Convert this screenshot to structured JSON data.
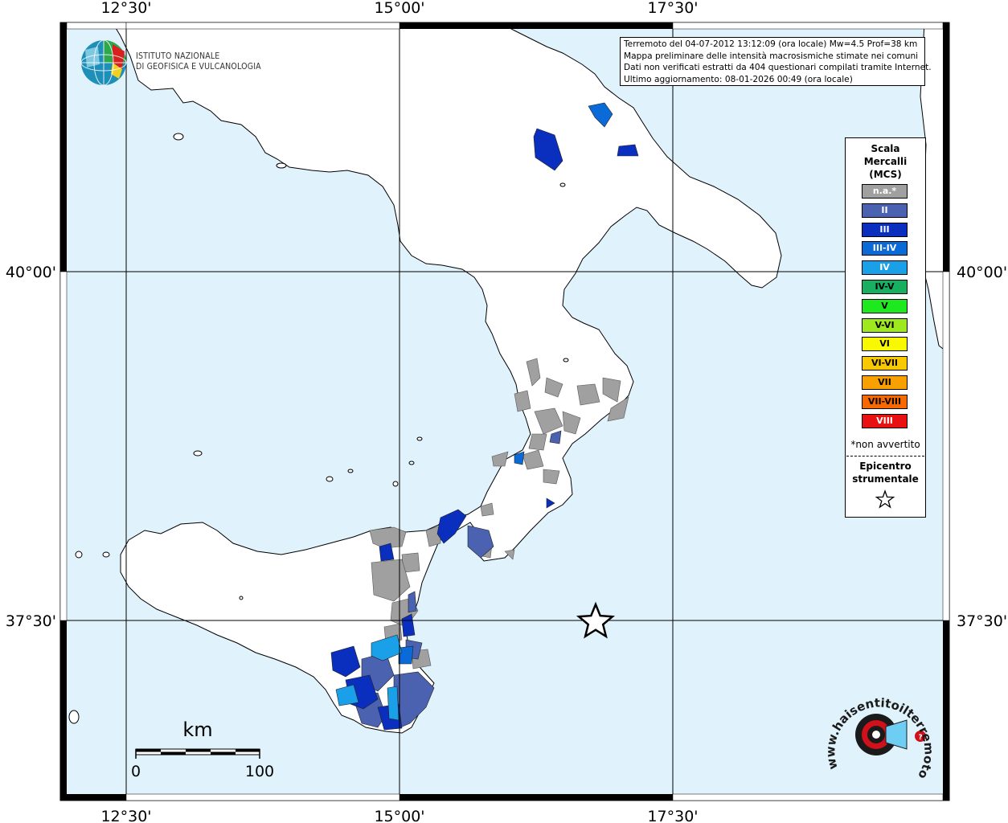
{
  "map": {
    "lon_labels": [
      "12°30'",
      "15°00'",
      "17°30'"
    ],
    "lat_labels": [
      "40°00'",
      "37°30'"
    ],
    "scale_bar": {
      "unit": "km",
      "start": "0",
      "end": "100"
    }
  },
  "logo": {
    "line1": "ISTITUTO NAZIONALE",
    "line2": "DI GEOFISICA E VULCANOLOGIA"
  },
  "info": {
    "line1": "Terremoto del 04-07-2012 13:12:09 (ora locale) Mw=4.5 Prof=38 km",
    "line2": "Mappa preliminare delle intensità macrosismiche stimate nei comuni",
    "line3": "Dati non verificati estratti da 404 questionari compilati tramite Internet.",
    "line4": "Ultimo aggiornamento: 08-01-2026 00:49 (ora locale)"
  },
  "legend": {
    "title_line1": "Scala",
    "title_line2": "Mercalli",
    "title_line3": "(MCS)",
    "items": [
      {
        "label": "n.a.*",
        "color": "#a0a0a0",
        "text_color": "#ffffff"
      },
      {
        "label": "II",
        "color": "#4a62b0",
        "text_color": "#ffffff"
      },
      {
        "label": "III",
        "color": "#0a2ebe",
        "text_color": "#ffffff"
      },
      {
        "label": "III-IV",
        "color": "#0a6ad8",
        "text_color": "#ffffff"
      },
      {
        "label": "IV",
        "color": "#1aa0e8",
        "text_color": "#ffffff"
      },
      {
        "label": "IV-V",
        "color": "#18b060",
        "text_color": "#000000"
      },
      {
        "label": "V",
        "color": "#1ee81e",
        "text_color": "#000000"
      },
      {
        "label": "V-VI",
        "color": "#9ee81e",
        "text_color": "#000000"
      },
      {
        "label": "VI",
        "color": "#f8f800",
        "text_color": "#000000"
      },
      {
        "label": "VI-VII",
        "color": "#f8c800",
        "text_color": "#000000"
      },
      {
        "label": "VII",
        "color": "#f8a000",
        "text_color": "#000000"
      },
      {
        "label": "VII-VIII",
        "color": "#f86800",
        "text_color": "#000000"
      },
      {
        "label": "VIII",
        "color": "#e81010",
        "text_color": "#ffffff"
      }
    ],
    "note": "*non avvertito",
    "epicenter_line1": "Epicentro",
    "epicenter_line2": "strumentale"
  },
  "colors": {
    "sea": "#e0f2fc",
    "land": "#ffffff",
    "coast": "#000000",
    "grid": "#000000",
    "hst_red": "#d0101a"
  },
  "hst_logo": {
    "text": "www.haisentitoilterremoto.it"
  }
}
